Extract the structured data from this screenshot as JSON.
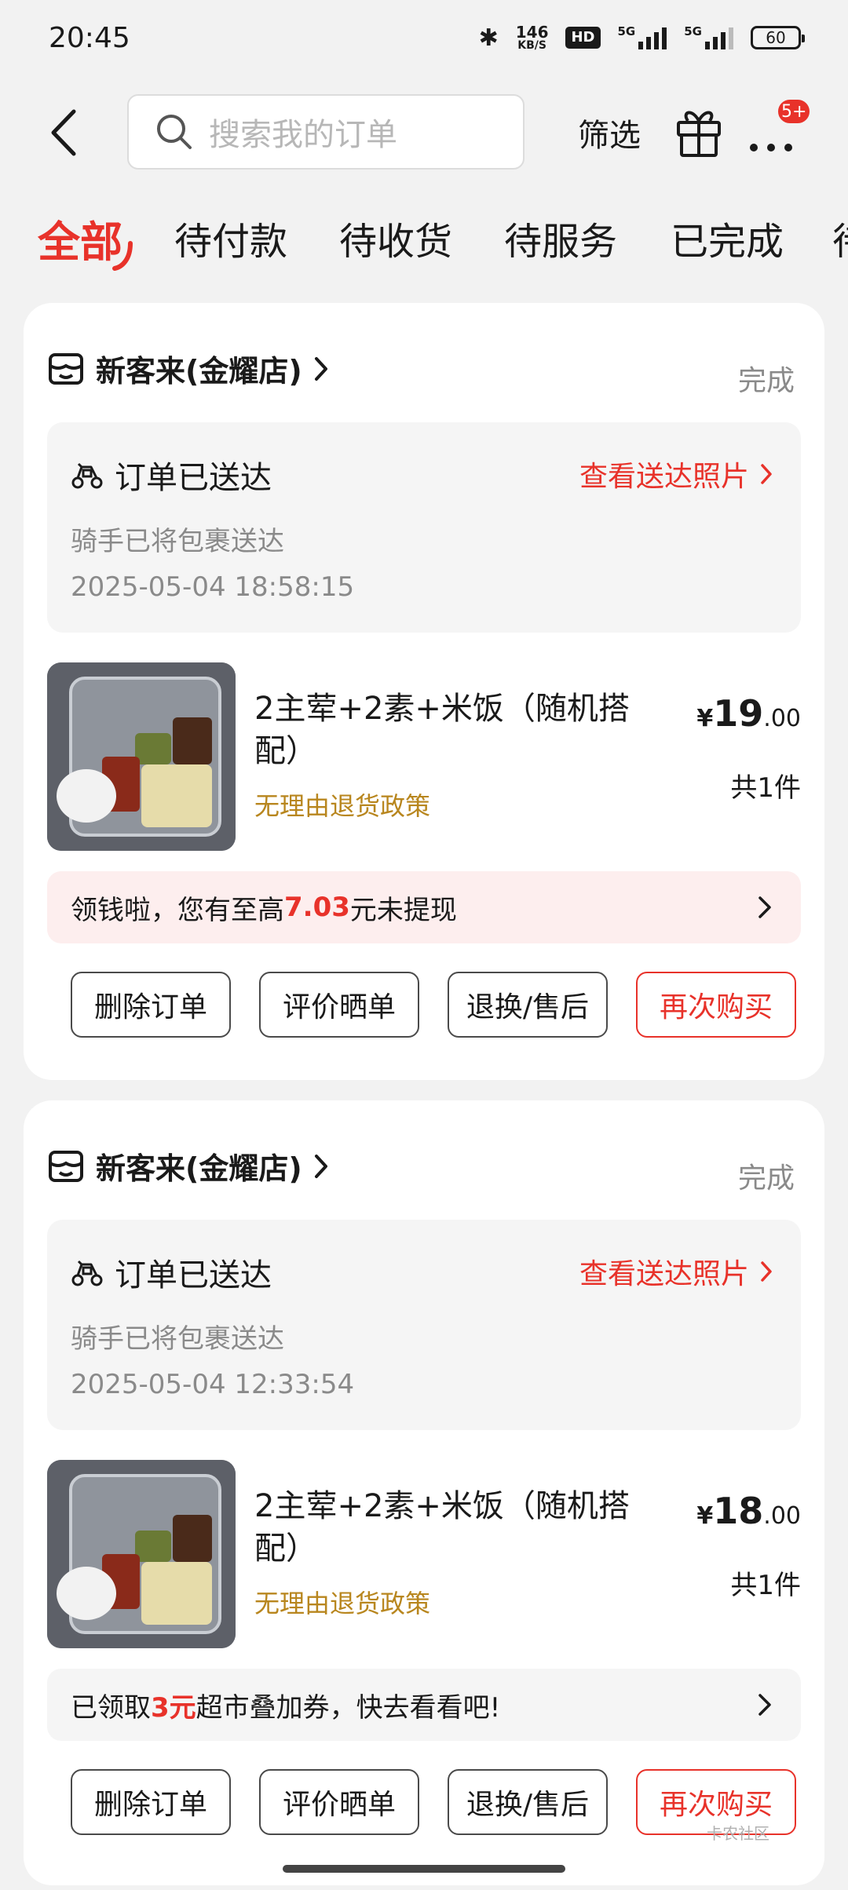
{
  "status_bar": {
    "time": "20:45",
    "net_speed_value": "146",
    "net_speed_unit": "KB/S",
    "hd": "HD",
    "sig1": "5G",
    "sig2": "5G",
    "battery": "60"
  },
  "top_bar": {
    "search_placeholder": "搜索我的订单",
    "filter_label": "筛选",
    "badge": "5+"
  },
  "tabs": [
    "全部",
    "待付款",
    "待收货",
    "待服务",
    "已完成",
    "待"
  ],
  "orders": [
    {
      "shop_name": "新客来(金耀店)",
      "status": "完成",
      "delivery_title": "订单已送达",
      "photo_link": "查看送达照片",
      "delivery_sub": "骑手已将包裹送达",
      "delivery_time": "2025-05-04 18:58:15",
      "item_name": "2主荤+2素+米饭（随机搭配）",
      "item_policy": "无理由退货政策",
      "price_currency": "¥",
      "price_int": "19",
      "price_dec": ".00",
      "qty": "共1件",
      "promo_pre": "领钱啦，您有至高",
      "promo_hl": "7.03",
      "promo_post": "元未提现",
      "buttons": [
        "删除订单",
        "评价晒单",
        "退换/售后",
        "再次购买"
      ]
    },
    {
      "shop_name": "新客来(金耀店)",
      "status": "完成",
      "delivery_title": "订单已送达",
      "photo_link": "查看送达照片",
      "delivery_sub": "骑手已将包裹送达",
      "delivery_time": "2025-05-04 12:33:54",
      "item_name": "2主荤+2素+米饭（随机搭配）",
      "item_policy": "无理由退货政策",
      "price_currency": "¥",
      "price_int": "18",
      "price_dec": ".00",
      "qty": "共1件",
      "promo_pre": "已领取",
      "promo_hl": "3元",
      "promo_post": "超市叠加券，快去看看吧!",
      "buttons": [
        "删除订单",
        "评价晒单",
        "退换/售后",
        "再次购买"
      ]
    }
  ],
  "watermark": "卡农社区",
  "colors": {
    "accent": "#e8322a",
    "policy": "#b8861e",
    "promo_bg_1": "#fdeeee",
    "promo_bg_2": "#f5f5f5"
  }
}
